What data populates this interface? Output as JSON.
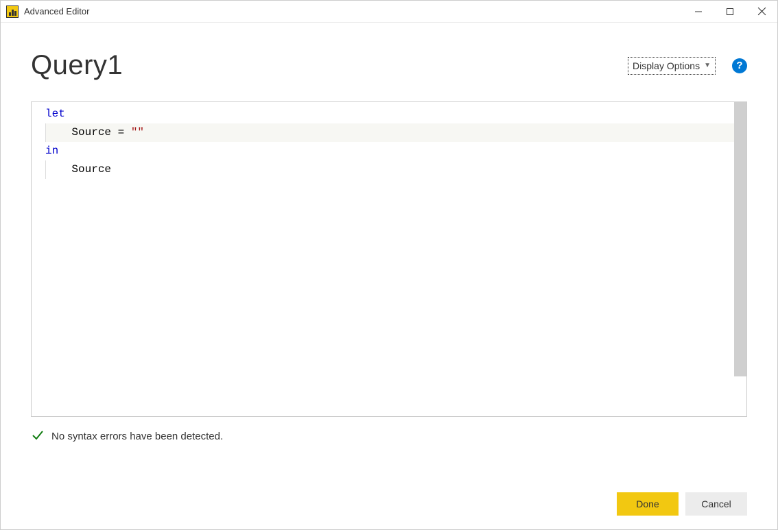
{
  "titlebar": {
    "title": "Advanced Editor"
  },
  "header": {
    "page_title": "Query1",
    "display_options_label": "Display Options"
  },
  "editor": {
    "lines": [
      {
        "tokens": [
          {
            "text": "let",
            "cls": "kw"
          }
        ],
        "indent": false,
        "hl": false
      },
      {
        "tokens": [
          {
            "text": "    Source = ",
            "cls": ""
          },
          {
            "text": "\"\"",
            "cls": "str"
          }
        ],
        "indent": true,
        "hl": true
      },
      {
        "tokens": [
          {
            "text": "in",
            "cls": "kw"
          }
        ],
        "indent": false,
        "hl": false
      },
      {
        "tokens": [
          {
            "text": "    Source",
            "cls": ""
          }
        ],
        "indent": true,
        "hl": false
      }
    ]
  },
  "status": {
    "message": "No syntax errors have been detected."
  },
  "footer": {
    "done_label": "Done",
    "cancel_label": "Cancel"
  }
}
